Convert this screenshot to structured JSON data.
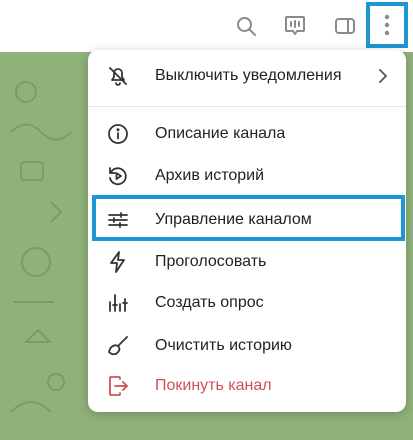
{
  "topbar": {
    "icons": [
      "search-icon",
      "live-stream-icon",
      "sidebar-toggle-icon",
      "more-vertical-icon"
    ]
  },
  "menu": {
    "items": [
      {
        "id": "mute",
        "icon": "bell-muted-icon",
        "label": "Выключить уведомления",
        "has_submenu": true
      },
      {
        "id": "info",
        "icon": "info-icon",
        "label": "Описание канала"
      },
      {
        "id": "stories",
        "icon": "stories-archive-icon",
        "label": "Архив историй"
      },
      {
        "id": "manage",
        "icon": "sliders-icon",
        "label": "Управление каналом",
        "highlighted": true
      },
      {
        "id": "boost",
        "icon": "lightning-icon",
        "label": "Проголосовать"
      },
      {
        "id": "poll",
        "icon": "poll-icon",
        "label": "Создать опрос"
      },
      {
        "id": "clear",
        "icon": "broom-icon",
        "label": "Очистить историю"
      },
      {
        "id": "leave",
        "icon": "leave-icon",
        "label": "Покинуть канал",
        "color": "#d14f55"
      }
    ]
  },
  "colors": {
    "accent_highlight": "#1e96d2",
    "chat_background": "#8fb17a",
    "danger": "#d14f55"
  }
}
